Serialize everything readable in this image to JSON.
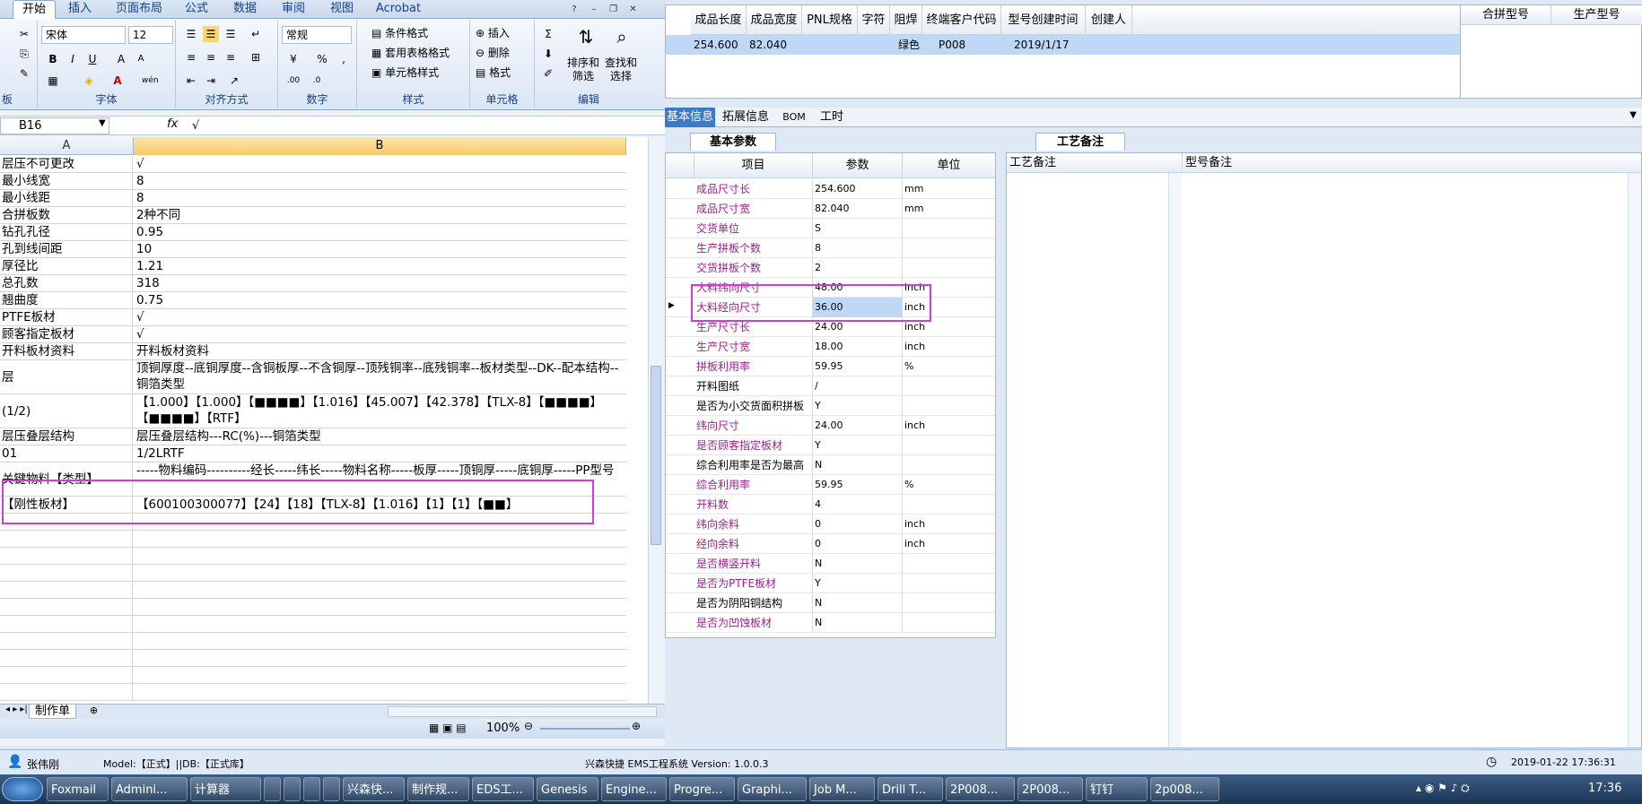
{
  "excel": {
    "tabs": [
      "开始",
      "插入",
      "页面布局",
      "公式",
      "数据",
      "审阅",
      "视图",
      "Acrobat"
    ],
    "font_name": "宋体",
    "font_size": "12",
    "number_format": "常规",
    "styles_items": [
      "条件格式",
      "套用表格格式",
      "单元格样式"
    ],
    "cells_items": [
      "插入",
      "删除",
      "格式"
    ],
    "edit_items": [
      "排序和\n筛选",
      "查找和\n选择"
    ],
    "group_labels": [
      "板",
      "字体",
      "对齐方式",
      "数字",
      "样式",
      "单元格",
      "编辑"
    ],
    "percent": "%",
    "name_box": "B16",
    "formula_value": "√",
    "col_a": "A",
    "col_b": "B",
    "rows": [
      {
        "a": "层压不可更改",
        "b": "√"
      },
      {
        "a": "最小线宽",
        "b": "8"
      },
      {
        "a": "最小线距",
        "b": "8"
      },
      {
        "a": "合拼板数",
        "b": "2种不同"
      },
      {
        "a": "钻孔孔径",
        "b": "0.95"
      },
      {
        "a": "孔到线间距",
        "b": "10"
      },
      {
        "a": "厚径比",
        "b": "1.21"
      },
      {
        "a": "总孔数",
        "b": "318"
      },
      {
        "a": "翘曲度",
        "b": "0.75"
      },
      {
        "a": "PTFE板材",
        "b": "√"
      },
      {
        "a": "顾客指定板材",
        "b": "√"
      },
      {
        "a": "开料板材资料",
        "b": "开料板材资料"
      },
      {
        "a": "层",
        "b": "顶铜厚度--底铜厚度--含铜板厚--不含铜厚--顶残铜率--底残铜率--板材类型--DK--配本结构--铜箔类型"
      },
      {
        "a": "(1/2)",
        "b": "【1.000】【1.000】【■■■■】【1.016】【45.007】【42.378】【TLX-8】【■■■■】【■■■■】【RTF】"
      },
      {
        "a": "层压叠层结构",
        "b": "层压叠层结构---RC(%)---铜箔类型"
      },
      {
        "a": "01",
        "b": "1/2LRTF"
      },
      {
        "a": "关键物料【类型】",
        "b": "-----物料编码----------经长-----纬长-----物料名称-----板厚-----顶铜厚-----底铜厚-----PP型号"
      },
      {
        "a": "【刚性板材】",
        "b": "【600100300077】【24】【18】【TLX-8】【1.016】【1】【1】【■■】"
      }
    ],
    "sheet_tab": "制作单",
    "zoom": "100%"
  },
  "app": {
    "top_headers": [
      "成品长度",
      "成品宽度",
      "PNL规格",
      "字符",
      "阻焊",
      "终端客户代码",
      "型号创建时间",
      "创建人"
    ],
    "top_row": [
      "254.600",
      "82.040",
      "",
      "",
      "绿色",
      "P008",
      "2019/1/17",
      ""
    ],
    "right_headers": [
      "合拼型号",
      "生产型号"
    ],
    "tabs": [
      "基本信息",
      "拓展信息",
      "BOM",
      "工时"
    ],
    "params_tab": "基本参数",
    "param_headers": [
      "项目",
      "参数",
      "单位"
    ],
    "params": [
      {
        "name": "成品尺寸长",
        "value": "254.600",
        "unit": "mm",
        "color": "purple"
      },
      {
        "name": "成品尺寸宽",
        "value": "82.040",
        "unit": "mm",
        "color": "purple"
      },
      {
        "name": "交货单位",
        "value": "S",
        "unit": "",
        "color": "purple"
      },
      {
        "name": "生产拼板个数",
        "value": "8",
        "unit": "",
        "color": "purple"
      },
      {
        "name": "交货拼板个数",
        "value": "2",
        "unit": "",
        "color": "purple"
      },
      {
        "name": "大料纬向尺寸",
        "value": "48.00",
        "unit": "inch",
        "color": "purple"
      },
      {
        "name": "大料经向尺寸",
        "value": "36.00",
        "unit": "inch",
        "color": "purple"
      },
      {
        "name": "生产尺寸长",
        "value": "24.00",
        "unit": "inch",
        "color": "purple"
      },
      {
        "name": "生产尺寸宽",
        "value": "18.00",
        "unit": "inch",
        "color": "purple"
      },
      {
        "name": "拼板利用率",
        "value": "59.95",
        "unit": "%",
        "color": "purple"
      },
      {
        "name": "开料图纸",
        "value": "/",
        "unit": "",
        "color": "black"
      },
      {
        "name": "是否为小交货面积拼板",
        "value": "Y",
        "unit": "",
        "color": "black"
      },
      {
        "name": "纬向尺寸",
        "value": "24.00",
        "unit": "inch",
        "color": "purple"
      },
      {
        "name": "是否顾客指定板材",
        "value": "Y",
        "unit": "",
        "color": "purple"
      },
      {
        "name": "综合利用率是否为最高",
        "value": "N",
        "unit": "",
        "color": "black"
      },
      {
        "name": "综合利用率",
        "value": "59.95",
        "unit": "%",
        "color": "purple"
      },
      {
        "name": "开料数",
        "value": "4",
        "unit": "",
        "color": "purple"
      },
      {
        "name": "纬向余料",
        "value": "0",
        "unit": "inch",
        "color": "purple"
      },
      {
        "name": "经向余料",
        "value": "0",
        "unit": "inch",
        "color": "purple"
      },
      {
        "name": "是否横竖开料",
        "value": "N",
        "unit": "",
        "color": "purple"
      },
      {
        "name": "是否为PTFE板材",
        "value": "Y",
        "unit": "",
        "color": "purple"
      },
      {
        "name": "是否为阴阳铜结构",
        "value": "N",
        "unit": "",
        "color": "black"
      },
      {
        "name": "是否为凹蚀板材",
        "value": "N",
        "unit": "",
        "color": "purple"
      }
    ],
    "notes_tab": "工艺备注",
    "notes_headers": [
      "工艺备注",
      "型号备注"
    ],
    "status_user": "张伟刚",
    "status_model": "Model:【正式】||DB:【正式库】",
    "status_app": "兴森快捷 EMS工程系统 Version: 1.0.0.3",
    "status_time": "2019-01-22 17:36:31"
  },
  "taskbar": {
    "items": [
      "Foxmail",
      "Admini...",
      "计算器",
      "",
      "",
      "",
      "",
      "兴森快...",
      "制作规...",
      "EDS工...",
      "Genesis",
      "Engine...",
      "Progre...",
      "Graphi...",
      "Job M...",
      "Drill T...",
      "2P008...",
      "2P008...",
      "钉钉",
      "2p008..."
    ],
    "clock": "17:36"
  }
}
